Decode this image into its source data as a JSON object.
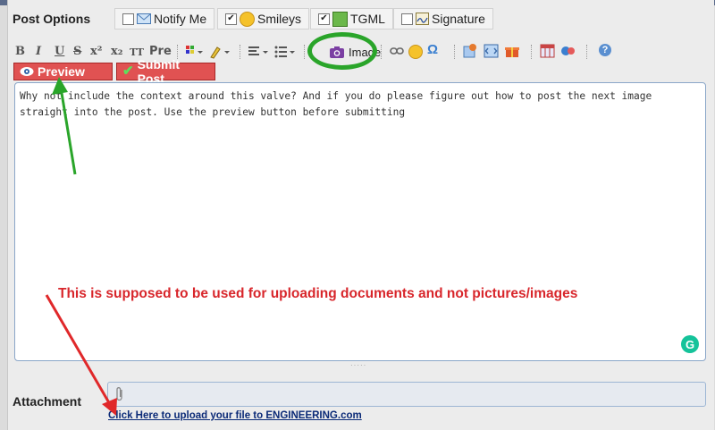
{
  "post_options": {
    "title": "Post Options",
    "notify_me": "Notify Me",
    "smileys": "Smileys",
    "tgml": "TGML",
    "signature": "Signature"
  },
  "toolbar": {
    "bold": "B",
    "italic": "I",
    "underline": "U",
    "strike": "S",
    "superscript": "x²",
    "subscript": "x₂",
    "teletype": "TT",
    "pre": "Pre",
    "image": "Image"
  },
  "actions": {
    "preview": "Preview",
    "submit": "Submit Post"
  },
  "editor": {
    "text": "Why not include the context around this valve? And if you do please figure out how to post the next image straight into the post. Use the preview button before submitting"
  },
  "annotation": "This is supposed to be used for uploading documents and not pictures/images",
  "attachment": {
    "label": "Attachment",
    "upload_link": "Click Here to upload your file to ENGINEERING.com"
  },
  "colors": {
    "accent_green": "#2aa52a",
    "annotation_red": "#d8262b",
    "button_red": "#e05252"
  }
}
